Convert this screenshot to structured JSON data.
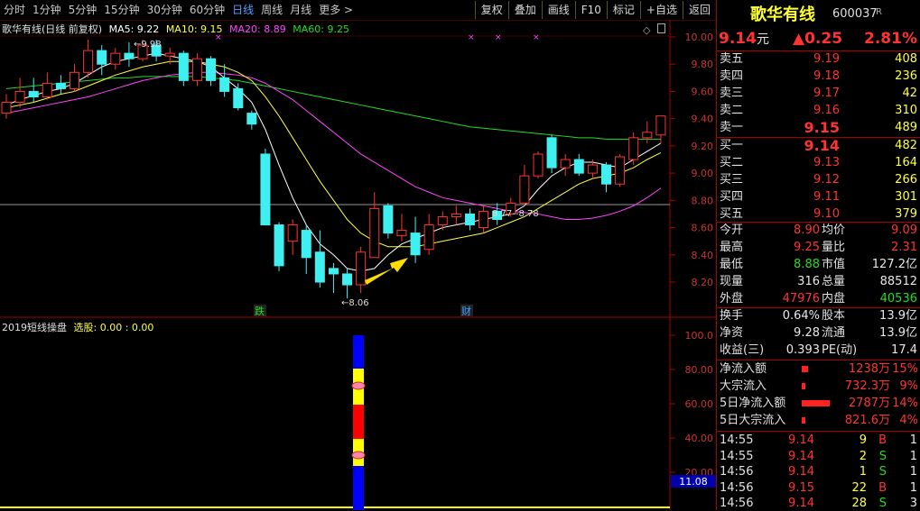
{
  "toolbar": {
    "periods": [
      "分时",
      "1分钟",
      "5分钟",
      "15分钟",
      "30分钟",
      "60分钟",
      "日线",
      "周线",
      "月线",
      "更多 >"
    ],
    "active_period": "日线",
    "buttons": [
      "复权",
      "叠加",
      "画线",
      "F10",
      "标记",
      "+自选",
      "返回"
    ]
  },
  "chart_header": {
    "title": "歌华有线(日线 前复权)",
    "ma5": "MA5: 9.22",
    "ma10": "MA10: 9.15",
    "ma20": "MA20: 8.89",
    "ma60": "MA60: 9.25"
  },
  "indicator_header": {
    "name": "2019短线操盘",
    "text": "选股: 0.00 : 0.00"
  },
  "annotations": {
    "high": "9.98",
    "low": "8.06",
    "mid": "8.77--8.78",
    "mark1": "跌",
    "mark2": "财"
  },
  "price_axis": [
    "10.00",
    "9.80",
    "9.60",
    "9.40",
    "9.20",
    "9.00",
    "8.80",
    "8.60",
    "8.40",
    "8.20"
  ],
  "indicator_axis": [
    "100.0",
    "80.00",
    "60.00",
    "40.00",
    "20.00"
  ],
  "indicator_value": "11.08",
  "colors": {
    "up": "#ff3333",
    "down": "#40f0f0",
    "ma5": "#ffffff",
    "ma10": "#ffff44",
    "ma20": "#ff44ff",
    "ma60": "#22dd22"
  },
  "quote": {
    "name": "歌华有线",
    "code": "600037",
    "flag": "R",
    "price": "9.14",
    "price_unit": "元",
    "change": "▲0.25",
    "change_pct": "2.81%",
    "asks": [
      {
        "label": "卖五",
        "price": "9.19",
        "vol": "408"
      },
      {
        "label": "卖四",
        "price": "9.18",
        "vol": "236"
      },
      {
        "label": "卖三",
        "price": "9.17",
        "vol": "42"
      },
      {
        "label": "卖二",
        "price": "9.16",
        "vol": "310"
      },
      {
        "label": "卖一",
        "price": "9.15",
        "vol": "489"
      }
    ],
    "bids": [
      {
        "label": "买一",
        "price": "9.14",
        "vol": "482"
      },
      {
        "label": "买二",
        "price": "9.13",
        "vol": "164"
      },
      {
        "label": "买三",
        "price": "9.12",
        "vol": "266"
      },
      {
        "label": "买四",
        "price": "9.11",
        "vol": "301"
      },
      {
        "label": "买五",
        "price": "9.10",
        "vol": "379"
      }
    ],
    "stats": [
      {
        "l1": "今开",
        "v1": "8.90",
        "l2": "均价",
        "v2": "9.09"
      },
      {
        "l1": "最高",
        "v1": "9.25",
        "l2": "量比",
        "v2": "2.31"
      },
      {
        "l1": "最低",
        "v1": "8.88",
        "l2": "市值",
        "v2": "127.2亿"
      },
      {
        "l1": "现量",
        "v1": "316",
        "l2": "总量",
        "v2": "88512"
      },
      {
        "l1": "外盘",
        "v1": "47976",
        "l2": "内盘",
        "v2": "40536"
      }
    ],
    "stats2": [
      {
        "l1": "换手",
        "v1": "0.64%",
        "l2": "股本",
        "v2": "13.9亿"
      },
      {
        "l1": "净资",
        "v1": "9.28",
        "l2": "流通",
        "v2": "13.9亿"
      },
      {
        "l1": "收益(三)",
        "v1": "0.393",
        "l2": "PE(动)",
        "v2": "17.4"
      }
    ],
    "flows": [
      {
        "label": "净流入额",
        "value": "1238万",
        "pct": "15%",
        "bar": 0.2
      },
      {
        "label": "大宗流入",
        "value": "732.3万",
        "pct": "9%",
        "bar": 0.1
      },
      {
        "label": "5日净流入额",
        "value": "2787万",
        "pct": "14%",
        "bar": 0.9
      },
      {
        "label": "5日大宗流入",
        "value": "821.6万",
        "pct": "4%",
        "bar": 0.1
      }
    ],
    "ticks": [
      {
        "time": "14:55",
        "price": "9.14",
        "vol": "9",
        "side": "B",
        "n": "1"
      },
      {
        "time": "14:55",
        "price": "9.14",
        "vol": "2",
        "side": "S",
        "n": "1"
      },
      {
        "time": "14:56",
        "price": "9.14",
        "vol": "1",
        "side": "S",
        "n": "1"
      },
      {
        "time": "14:56",
        "price": "9.15",
        "vol": "22",
        "side": "B",
        "n": "1"
      },
      {
        "time": "14:56",
        "price": "9.14",
        "vol": "28",
        "side": "S",
        "n": "3"
      }
    ]
  },
  "chart_data": {
    "type": "candlestick",
    "ylim": [
      8.1,
      10.05
    ],
    "candles": [
      {
        "o": 9.44,
        "c": 9.52,
        "h": 9.58,
        "l": 9.4
      },
      {
        "o": 9.52,
        "c": 9.6,
        "h": 9.7,
        "l": 9.48
      },
      {
        "o": 9.6,
        "c": 9.56,
        "h": 9.7,
        "l": 9.52
      },
      {
        "o": 9.56,
        "c": 9.66,
        "h": 9.74,
        "l": 9.54
      },
      {
        "o": 9.66,
        "c": 9.62,
        "h": 9.72,
        "l": 9.58
      },
      {
        "o": 9.62,
        "c": 9.74,
        "h": 9.8,
        "l": 9.6
      },
      {
        "o": 9.74,
        "c": 9.9,
        "h": 9.98,
        "l": 9.7
      },
      {
        "o": 9.9,
        "c": 9.8,
        "h": 9.94,
        "l": 9.72
      },
      {
        "o": 9.8,
        "c": 9.88,
        "h": 9.92,
        "l": 9.76
      },
      {
        "o": 9.88,
        "c": 9.84,
        "h": 9.96,
        "l": 9.78
      },
      {
        "o": 9.84,
        "c": 9.94,
        "h": 9.98,
        "l": 9.82
      },
      {
        "o": 9.94,
        "c": 9.86,
        "h": 9.98,
        "l": 9.82
      },
      {
        "o": 9.86,
        "c": 9.88,
        "h": 9.92,
        "l": 9.8
      },
      {
        "o": 9.88,
        "c": 9.68,
        "h": 9.9,
        "l": 9.64
      },
      {
        "o": 9.68,
        "c": 9.84,
        "h": 9.88,
        "l": 9.64
      },
      {
        "o": 9.84,
        "c": 9.68,
        "h": 9.86,
        "l": 9.64
      },
      {
        "o": 9.7,
        "c": 9.6,
        "h": 9.8,
        "l": 9.56
      },
      {
        "o": 9.62,
        "c": 9.48,
        "h": 9.66,
        "l": 9.46
      },
      {
        "o": 9.44,
        "c": 9.36,
        "h": 9.46,
        "l": 9.32
      },
      {
        "o": 9.14,
        "c": 8.62,
        "h": 9.18,
        "l": 8.62
      },
      {
        "o": 8.62,
        "c": 8.32,
        "h": 8.64,
        "l": 8.28
      },
      {
        "o": 8.5,
        "c": 8.62,
        "h": 8.66,
        "l": 8.4
      },
      {
        "o": 8.58,
        "c": 8.38,
        "h": 8.62,
        "l": 8.26
      },
      {
        "o": 8.42,
        "c": 8.2,
        "h": 8.58,
        "l": 8.16
      },
      {
        "o": 8.3,
        "c": 8.26,
        "h": 8.34,
        "l": 8.12
      },
      {
        "o": 8.26,
        "c": 8.18,
        "h": 8.3,
        "l": 8.08
      },
      {
        "o": 8.18,
        "c": 8.42,
        "h": 8.46,
        "l": 8.12
      },
      {
        "o": 8.38,
        "c": 8.74,
        "h": 8.86,
        "l": 8.38
      },
      {
        "o": 8.76,
        "c": 8.56,
        "h": 8.78,
        "l": 8.52
      },
      {
        "o": 8.54,
        "c": 8.58,
        "h": 8.7,
        "l": 8.5
      },
      {
        "o": 8.56,
        "c": 8.4,
        "h": 8.68,
        "l": 8.34
      },
      {
        "o": 8.44,
        "c": 8.62,
        "h": 8.7,
        "l": 8.4
      },
      {
        "o": 8.62,
        "c": 8.68,
        "h": 8.72,
        "l": 8.58
      },
      {
        "o": 8.68,
        "c": 8.7,
        "h": 8.76,
        "l": 8.62
      },
      {
        "o": 8.7,
        "c": 8.62,
        "h": 8.74,
        "l": 8.58
      },
      {
        "o": 8.6,
        "c": 8.72,
        "h": 8.76,
        "l": 8.56
      },
      {
        "o": 8.72,
        "c": 8.66,
        "h": 8.78,
        "l": 8.62
      },
      {
        "o": 8.7,
        "c": 8.78,
        "h": 8.82,
        "l": 8.68
      },
      {
        "o": 8.78,
        "c": 8.98,
        "h": 9.06,
        "l": 8.76
      },
      {
        "o": 8.98,
        "c": 9.14,
        "h": 9.16,
        "l": 8.96
      },
      {
        "o": 9.26,
        "c": 9.04,
        "h": 9.28,
        "l": 9.0
      },
      {
        "o": 9.04,
        "c": 9.1,
        "h": 9.14,
        "l": 8.98
      },
      {
        "o": 9.1,
        "c": 9.0,
        "h": 9.14,
        "l": 8.98
      },
      {
        "o": 9.0,
        "c": 9.06,
        "h": 9.1,
        "l": 8.96
      },
      {
        "o": 9.06,
        "c": 8.92,
        "h": 9.08,
        "l": 8.86
      },
      {
        "o": 8.92,
        "c": 9.12,
        "h": 9.14,
        "l": 8.9
      },
      {
        "o": 9.1,
        "c": 9.26,
        "h": 9.3,
        "l": 9.06
      },
      {
        "o": 9.26,
        "c": 9.3,
        "h": 9.38,
        "l": 9.22
      },
      {
        "o": 9.28,
        "c": 9.42,
        "h": 9.42,
        "l": 9.22
      }
    ],
    "ma5": [
      9.5,
      9.54,
      9.57,
      9.6,
      9.62,
      9.66,
      9.72,
      9.78,
      9.82,
      9.84,
      9.86,
      9.88,
      9.86,
      9.84,
      9.82,
      9.78,
      9.7,
      9.62,
      9.52,
      9.32,
      9.06,
      8.82,
      8.62,
      8.48,
      8.4,
      8.3,
      8.28,
      8.3,
      8.4,
      8.48,
      8.52,
      8.56,
      8.6,
      8.62,
      8.64,
      8.66,
      8.68,
      8.7,
      8.76,
      8.88,
      8.98,
      9.04,
      9.08,
      9.08,
      9.06,
      9.04,
      9.1,
      9.16,
      9.22
    ],
    "ma10": [
      9.48,
      9.5,
      9.52,
      9.55,
      9.58,
      9.6,
      9.64,
      9.68,
      9.72,
      9.75,
      9.78,
      9.8,
      9.82,
      9.82,
      9.82,
      9.8,
      9.78,
      9.74,
      9.68,
      9.56,
      9.42,
      9.26,
      9.1,
      8.94,
      8.8,
      8.66,
      8.56,
      8.5,
      8.46,
      8.46,
      8.46,
      8.48,
      8.5,
      8.52,
      8.54,
      8.56,
      8.6,
      8.64,
      8.68,
      8.74,
      8.8,
      8.86,
      8.92,
      8.96,
      8.98,
      9.0,
      9.04,
      9.1,
      9.15
    ],
    "ma20": [
      9.44,
      9.46,
      9.48,
      9.5,
      9.52,
      9.54,
      9.56,
      9.59,
      9.62,
      9.65,
      9.68,
      9.7,
      9.72,
      9.73,
      9.74,
      9.74,
      9.73,
      9.72,
      9.7,
      9.66,
      9.6,
      9.54,
      9.46,
      9.38,
      9.3,
      9.22,
      9.14,
      9.08,
      9.02,
      8.96,
      8.9,
      8.86,
      8.82,
      8.8,
      8.78,
      8.76,
      8.74,
      8.72,
      8.71,
      8.7,
      8.68,
      8.66,
      8.66,
      8.67,
      8.69,
      8.72,
      8.76,
      8.82,
      8.89
    ],
    "ma60": [
      9.62,
      9.63,
      9.64,
      9.65,
      9.66,
      9.67,
      9.68,
      9.69,
      9.7,
      9.7,
      9.71,
      9.71,
      9.71,
      9.71,
      9.71,
      9.7,
      9.69,
      9.68,
      9.66,
      9.64,
      9.62,
      9.6,
      9.58,
      9.56,
      9.54,
      9.52,
      9.5,
      9.48,
      9.46,
      9.44,
      9.42,
      9.4,
      9.38,
      9.36,
      9.34,
      9.33,
      9.32,
      9.31,
      9.3,
      9.29,
      9.28,
      9.27,
      9.26,
      9.26,
      9.25,
      9.25,
      9.25,
      9.25,
      9.25
    ]
  }
}
